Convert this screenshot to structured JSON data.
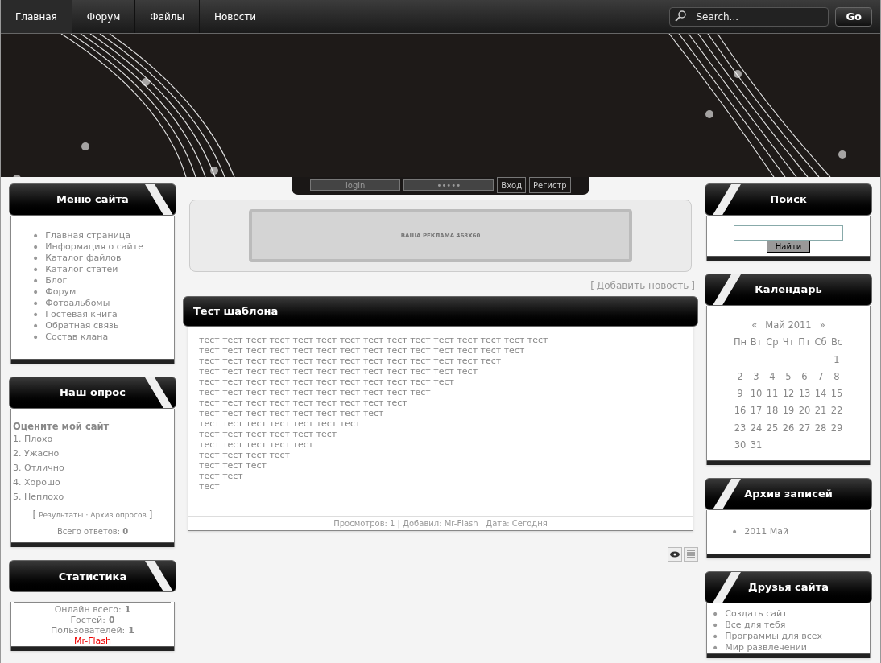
{
  "nav": [
    {
      "label": "Главная",
      "selected": true
    },
    {
      "label": "Форум",
      "selected": false
    },
    {
      "label": "Файлы",
      "selected": false
    },
    {
      "label": "Новости",
      "selected": false
    }
  ],
  "search": {
    "placeholder": "Search...",
    "button": "Go"
  },
  "login": {
    "login_placeholder": "login",
    "password_placeholder": "•••••",
    "enter": "Вход",
    "register": "Регистр"
  },
  "ad": {
    "text": "ВАША РЕКЛАМА 468Х60"
  },
  "add_news": {
    "open": "[",
    "link": "Добавить новость",
    "close": "]"
  },
  "menu": {
    "title": "Меню сайта",
    "bullet": "•",
    "items": [
      "Главная страница",
      "Информация о сайте",
      "Каталог файлов",
      "Каталог статей",
      "Блог",
      "Форум",
      "Фотоальбомы",
      "Гостевая книга",
      "Обратная связь",
      "Состав клана"
    ]
  },
  "poll": {
    "title": "Наш опрос",
    "question": "Оцените мой сайт",
    "options": [
      "1. Плохо",
      "2. Ужасно",
      "3. Отлично",
      "4. Хорошо",
      "5. Неплохо"
    ],
    "open": "[",
    "results": "Результаты",
    "separator": "·",
    "archive": "Архив опросов",
    "close": "]",
    "total_label": "Всего ответов:",
    "total": "0"
  },
  "stats": {
    "title": "Статистика",
    "rows": [
      {
        "label": "Онлайн всего:",
        "value": "1"
      },
      {
        "label": "Гостей:",
        "value": "0"
      },
      {
        "label": "Пользователей:",
        "value": "1"
      }
    ],
    "user": "Mr-Flash"
  },
  "post": {
    "title": "Тест шаблона",
    "lines": [
      "тест тест тест тест тест тест тест тест тест тест тест тест тест тест тест",
      "тест тест тест тест тест тест тест тест тест тест тест тест тест тест",
      "тест тест тест тест тест тест тест тест тест тест тест тест тест",
      "тест тест тест тест тест тест тест тест тест тест тест тест",
      "тест тест тест тест тест тест тест тест тест тест тест",
      "тест тест тест тест тест тест тест тест тест тест",
      "тест тест тест тест тест тест тест тест тест",
      "тест тест тест тест тест тест тест тест",
      "тест тест тест тест тест тест тест",
      "тест тест тест тест тест тест",
      "тест тест тест тест тест",
      "тест тест тест тест",
      "тест тест тест",
      "тест тест",
      "тест"
    ],
    "footer": "Просмотров: 1 | Добавил: Mr-Flash | Дата: Сегодня"
  },
  "site_search": {
    "title": "Поиск",
    "button": "Найти"
  },
  "calendar": {
    "title": "Календарь",
    "prev": "«",
    "month": "Май 2011",
    "next": "»",
    "weekdays": [
      "Пн",
      "Вт",
      "Ср",
      "Чт",
      "Пт",
      "Сб",
      "Вс"
    ],
    "weeks": [
      [
        "1"
      ],
      [
        "2",
        "3",
        "4",
        "5",
        "6",
        "7",
        "8"
      ],
      [
        "9",
        "10",
        "11",
        "12",
        "13",
        "14",
        "15"
      ],
      [
        "16",
        "17",
        "18",
        "19",
        "20",
        "21",
        "22"
      ],
      [
        "23",
        "24",
        "25",
        "26",
        "27",
        "28",
        "29"
      ],
      [
        "30",
        "31"
      ]
    ]
  },
  "archive": {
    "title": "Архив записей",
    "bullet": "•",
    "items": [
      "2011 Май"
    ]
  },
  "friends": {
    "title": "Друзья сайта",
    "bullet": "•",
    "items": [
      "Создать сайт",
      "Все для тебя",
      "Программы для всех",
      "Мир развлечений"
    ]
  }
}
